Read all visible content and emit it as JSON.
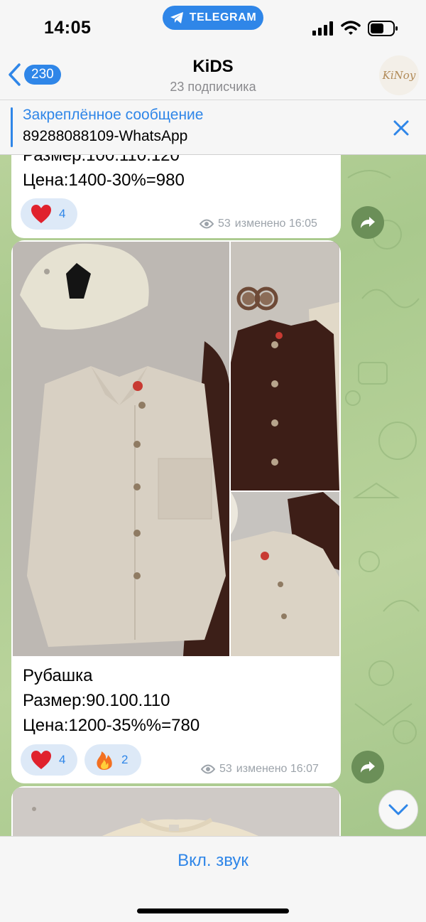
{
  "status_bar": {
    "time": "14:05",
    "return_app": "TELEGRAM"
  },
  "header": {
    "back_count": "230",
    "title": "KiDS",
    "subtitle": "23 подписчика",
    "avatar_text": "KiNoy"
  },
  "pinned": {
    "title": "Закреплённое сообщение",
    "text": "89288088109-WhatsApp"
  },
  "messages": [
    {
      "lines": [
        "Размер:100.110.120",
        "Цена:1400-30%=980"
      ],
      "reactions": [
        {
          "emoji": "heart",
          "count": "4"
        }
      ],
      "views": "53",
      "edited_time": "изменено 16:05"
    },
    {
      "photos": [
        {
          "subject": "beige shirt with cap"
        },
        {
          "subject": "brown shirt with sunglasses"
        },
        {
          "subject": "beige shirt closeup"
        }
      ],
      "lines": [
        "Рубашка",
        "Размер:90.100.110",
        "Цена:1200-35%%=780"
      ],
      "reactions": [
        {
          "emoji": "heart",
          "count": "4"
        },
        {
          "emoji": "fire",
          "count": "2"
        }
      ],
      "views": "53",
      "edited_time": "изменено 16:07"
    },
    {
      "photos": [
        {
          "subject": "cream sweater"
        }
      ]
    }
  ],
  "bottom": {
    "unmute_label": "Вкл. звук"
  },
  "colors": {
    "accent": "#2f86e8",
    "bubble": "#ffffff",
    "reaction_bg": "#dde9f7",
    "share_button": "#6b8f58"
  }
}
